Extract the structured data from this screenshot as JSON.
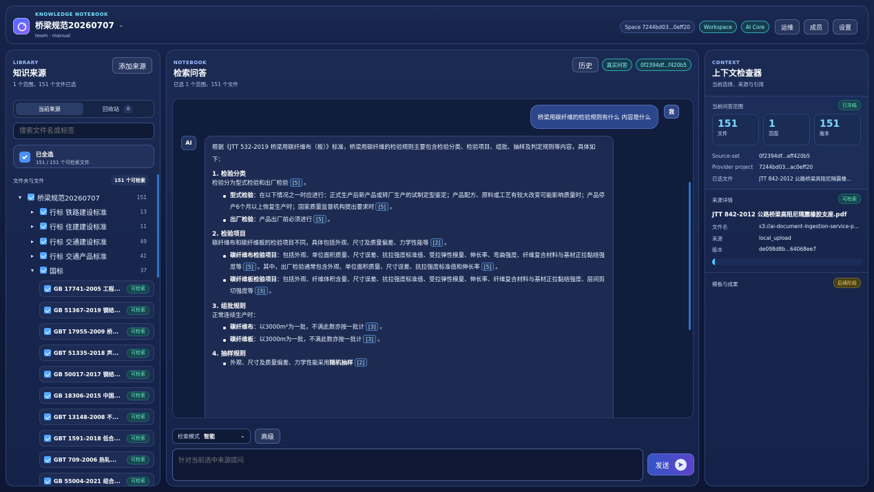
{
  "header": {
    "kicker": "KNOWLEDGE NOTEBOOK",
    "title": "桥梁规范20260707",
    "subtitle": "team · manual",
    "space_pill": "Space 7244bd03...0eff20",
    "workspace_pill": "Workspace",
    "ai_core_pill": "AI Core",
    "buttons": [
      "运维",
      "成员",
      "设置"
    ]
  },
  "library": {
    "kicker": "LIBRARY",
    "title": "知识来源",
    "subtitle": "1 个范围，151 个文件已选",
    "add_button": "添加来源",
    "tabs": [
      {
        "label": "当前来源"
      },
      {
        "label": "回收站",
        "badge": "0"
      }
    ],
    "search_placeholder": "搜索文件名或标签",
    "select_all": {
      "title": "已全选",
      "sub": "151 / 151 个可检索文件"
    },
    "folder_label": "文件夹与文件",
    "folder_badge": "151 个可检索",
    "root": {
      "name": "桥梁规范20260707",
      "count": "151"
    },
    "groups": [
      {
        "name": "行标 铁路建设标准",
        "count": "13"
      },
      {
        "name": "行标 住建建设标准",
        "count": "11"
      },
      {
        "name": "行标 交通建设标准",
        "count": "49"
      },
      {
        "name": "行标 交通产品标准",
        "count": "41"
      },
      {
        "name": "国标",
        "count": "37"
      }
    ],
    "docs": [
      {
        "title": "GB 17741-2005 工程...",
        "status": "可检索"
      },
      {
        "title": "GB 51367-2019 钢结...",
        "status": "可检索"
      },
      {
        "title": "GBT 17955-2009 桥...",
        "status": "可检索"
      },
      {
        "title": "GBT 51335-2018 声...",
        "status": "可检索"
      },
      {
        "title": "GB 50017-2017 钢结...",
        "status": "可检索"
      },
      {
        "title": "GB 18306-2015 中国...",
        "status": "可检索"
      },
      {
        "title": "GBT 13148-2008 不...",
        "status": "可检索"
      },
      {
        "title": "GBT 1591-2018 低合...",
        "status": "可检索"
      },
      {
        "title": "GBT 709-2006 热轧...",
        "status": "可检索"
      },
      {
        "title": "GB 55004-2021 组合...",
        "status": "可检索"
      }
    ]
  },
  "notebook": {
    "kicker": "NOTEBOOK",
    "title": "检索问答",
    "subtitle": "已选 1 个范围，151 个文件",
    "history_button": "历史",
    "real_qa_pill": "真实问答",
    "session_pill": "0f2394df...f420b5",
    "user_avatar": "我",
    "ai_avatar": "AI",
    "user_message": "桥梁用碳纤维的检验规则有什么 内容是什么",
    "answer": {
      "intro": "根据《JTT 532-2019 桥梁用碳纤维布（板）》标准，桥梁用碳纤维的检验规则主要包含检验分类、检验项目、组批、抽样及判定规则等内容，具体如下：",
      "s1_title": "1. 检验分类",
      "s1_text": "检验分为型式检验和出厂检验",
      "s1_cite": "[5]",
      "s1_b1_label": "型式检验",
      "s1_b1_text": "：在以下情况之一时应进行：正式生产后新产品或转厂生产的试制定型鉴定；产品配方、原料或工艺有较大改变可能影响质量时；产品停产6个月以上恢复生产时；国家质量监督机构提出要求时",
      "s1_b1_cite": "[5]",
      "s1_b2_label": "出厂检验",
      "s1_b2_text": "：产品出厂前必须进行",
      "s1_b2_cite": "[5]",
      "s2_title": "2. 检验项目",
      "s2_text": "碳纤维布和碳纤维板的检验项目不同，具体包括外观、尺寸及质量偏差、力学性能等",
      "s2_cite": "[2]",
      "s2_b1_label": "碳纤维布检验项目",
      "s2_b1_text": "：包括外观、单位面积质量、尺寸误差、抗拉强度标准值、受拉弹性模量、伸长率、弯曲强度、纤维复合材料与基材正拉黏结强度等",
      "s2_b1_cite": "[5]",
      "s2_b1_text2": "。其中，出厂检验通常包含外观、单位面积质量、尺寸误差、抗拉强度标准值和伸长率",
      "s2_b1_cite2": "[5]",
      "s2_b2_label": "碳纤维板检验项目",
      "s2_b2_text": "：包括外观、纤维体积含量、尺寸误差、抗拉强度标准值、受拉弹性模量、伸长率、纤维复合材料与基材正拉黏结强度、层间剪切强度等",
      "s2_b2_cite": "[3]",
      "s3_title": "3. 组批规则",
      "s3_text": "正常连续生产时：",
      "s3_b1_label": "碳纤维布",
      "s3_b1_text": "：以3000m²为一批，不满此数亦按一批计",
      "s3_b1_cite": "[3]",
      "s3_b2_label": "碳纤维板",
      "s3_b2_text": "：以3000m为一批，不满此数亦按一批计",
      "s3_b2_cite": "[3]",
      "s4_title": "4. 抽样规则",
      "s4_b1_text": "外观、尺寸及质量偏差、力学性能采用",
      "s4_b1_label": "随机抽样",
      "s4_b1_cite": "[2]"
    },
    "mode_label": "检索模式",
    "mode_value": "智能",
    "advanced_button": "高级",
    "input_placeholder": "针对当前选中来源提问",
    "send_button": "发送"
  },
  "context": {
    "kicker": "CONTEXT",
    "title": "上下文检查器",
    "subtitle": "当前选择、来源与引用",
    "scope_label": "当前问答范围",
    "scope_badge": "已冻结",
    "stats": [
      {
        "value": "151",
        "label": "文件"
      },
      {
        "value": "1",
        "label": "范围"
      },
      {
        "value": "151",
        "label": "版本"
      }
    ],
    "kv": [
      {
        "key": "Source-set",
        "value": "0f2394df...aff420b5"
      },
      {
        "key": "Provider project",
        "value": "7244bd03...ac0eff20"
      },
      {
        "key": "已选文件",
        "value": "JTT 842-2012 公路桥梁高阻尼隔震橡..."
      }
    ],
    "source_label": "来源详情",
    "source_badge": "可检索",
    "source_title": "JTT 842-2012 公路桥梁高阻尼隔震橡胶支座.pdf",
    "source_kv": [
      {
        "key": "文件名",
        "value": "s3://ai-document-ingestion-service-p..."
      },
      {
        "key": "来源",
        "value": "local_upload"
      },
      {
        "key": "版本",
        "value": "de098d8b...64068ee7"
      }
    ],
    "progress": 0.02,
    "templates_label": "模板与成果",
    "templates_badge": "后续阶段"
  },
  "colors": {
    "accent": "#52a8ff",
    "cyan": "#74e1ff",
    "green": "#69f2c8",
    "amber": "#ffcf58"
  }
}
